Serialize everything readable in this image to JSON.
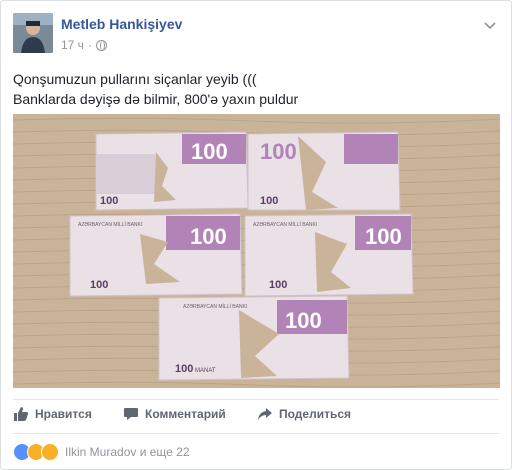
{
  "post": {
    "author": "Metleb Hankişiyev",
    "time": "17 ч",
    "separator": "·",
    "text_lines": [
      "Qonşumuzun pullarını siçanlar yeyib (((",
      "Banklarda dəyişə də bilmir, 800'ə yaxın puldur"
    ]
  },
  "banknote": {
    "denomination": "100",
    "currency": "MANAT",
    "bank": "AZƏRBAYCAN MİLLİ BANKI"
  },
  "actions": {
    "like": "Нравится",
    "comment": "Комментарий",
    "share": "Поделиться"
  },
  "reactions": {
    "label": "Ilkin Muradov и еще 22"
  },
  "colors": {
    "author": "#365899",
    "note": "#b283b6",
    "table": "#c9b49a"
  }
}
